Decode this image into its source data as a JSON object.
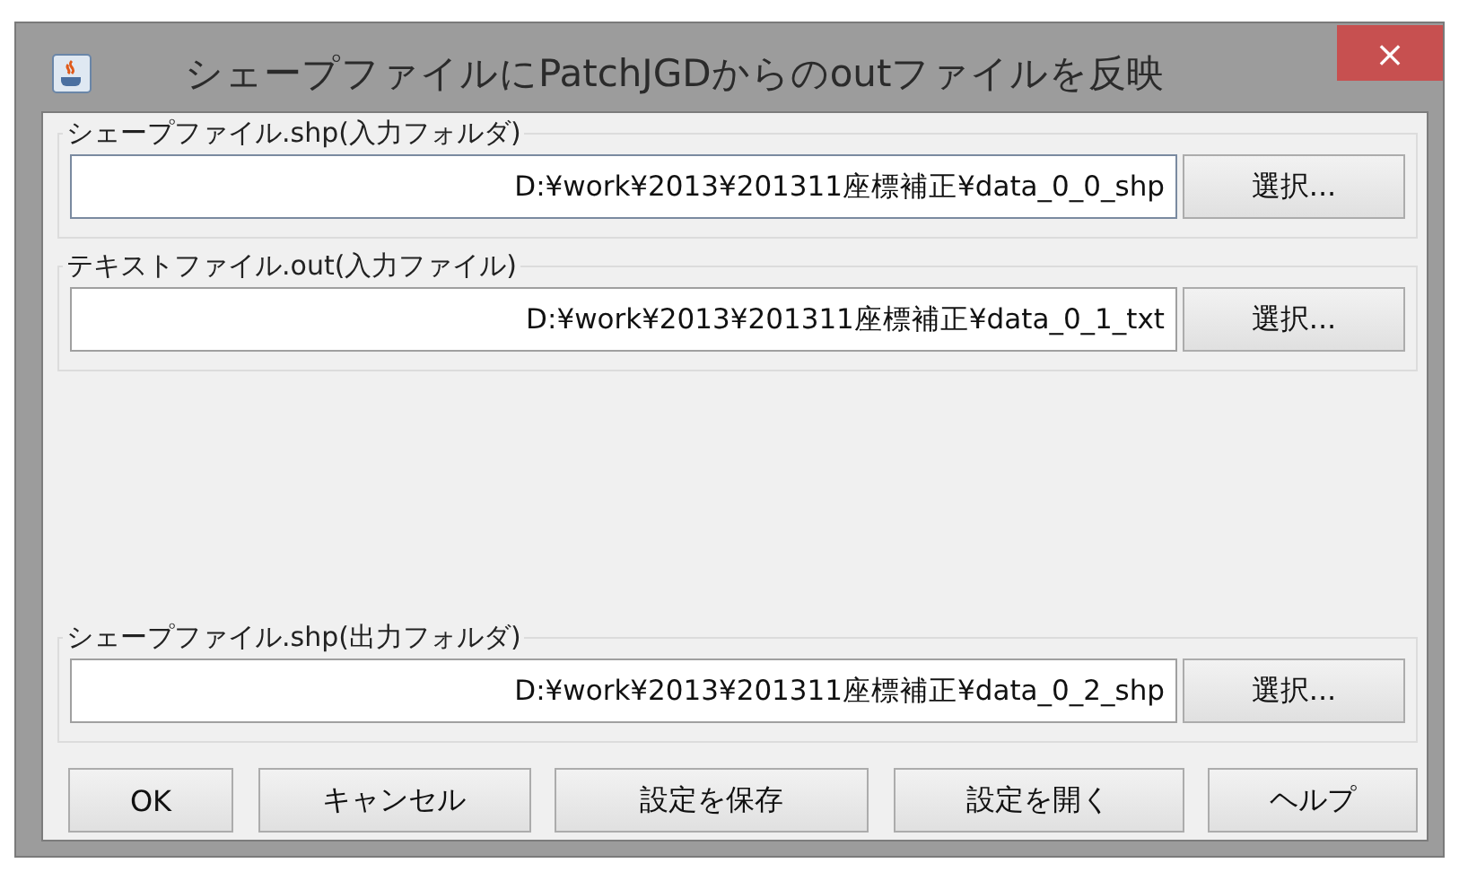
{
  "window": {
    "title": "シェープファイルにPatchJGDからのoutファイルを反映",
    "close": "×"
  },
  "groups": [
    {
      "legend": "シェープファイル.shp(入力フォルダ)",
      "value": "D:¥work¥2013¥201311座標補正¥data_0_0_shp",
      "focused": true,
      "button": "選択..."
    },
    {
      "legend": "テキストファイル.out(入力ファイル)",
      "value": "D:¥work¥2013¥201311座標補正¥data_0_1_txt",
      "focused": false,
      "button": "選択..."
    },
    {
      "legend": "シェープファイル.shp(出力フォルダ)",
      "value": "D:¥work¥2013¥201311座標補正¥data_0_2_shp",
      "focused": false,
      "button": "選択..."
    }
  ],
  "buttons": [
    "OK",
    "キャンセル",
    "設定を保存",
    "設定を開く",
    "ヘルプ"
  ]
}
